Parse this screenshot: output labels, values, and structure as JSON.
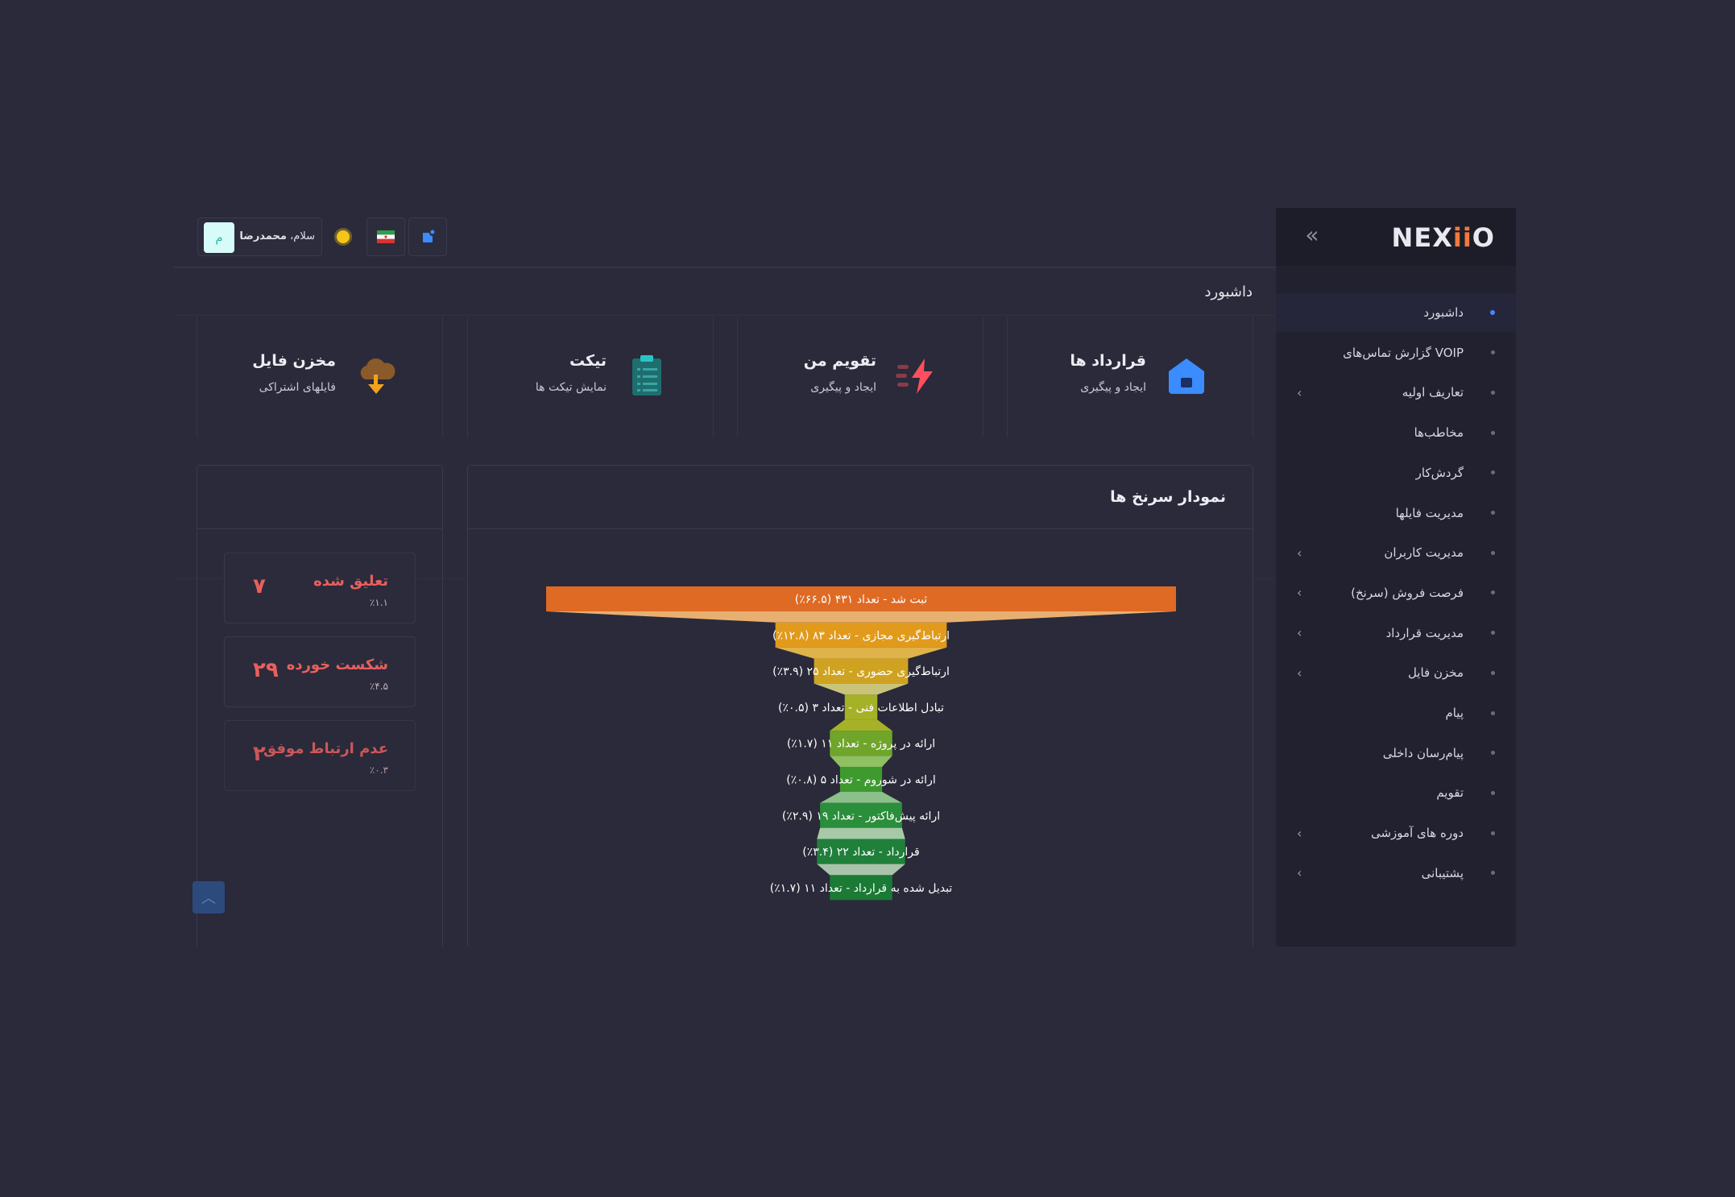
{
  "brand": {
    "logo_prefix": "NEX",
    "logo_ii": "ii",
    "logo_suffix": "O"
  },
  "sidebar": {
    "items": [
      {
        "label": "داشبورد",
        "active": true,
        "chevron": false
      },
      {
        "label": "گزارش تماس‌های VOIP",
        "chevron": false
      },
      {
        "label": "تعاریف اولیه",
        "chevron": true
      },
      {
        "label": "مخاطب‌ها",
        "chevron": false
      },
      {
        "label": "گردش‌کار",
        "chevron": false
      },
      {
        "label": "مدیریت فایلها",
        "chevron": false
      },
      {
        "label": "مدیریت کاربران",
        "chevron": true
      },
      {
        "label": "فرصت فروش (سرنخ)",
        "chevron": true
      },
      {
        "label": "مدیریت قرارداد",
        "chevron": true
      },
      {
        "label": "مخزن فایل",
        "chevron": true
      },
      {
        "label": "پیام",
        "chevron": false
      },
      {
        "label": "پیام‌رسان داخلی",
        "chevron": false
      },
      {
        "label": "تقویم",
        "chevron": false
      },
      {
        "label": "دوره های آموزشی",
        "chevron": true
      },
      {
        "label": "پشتیبانی",
        "chevron": true
      }
    ],
    "chevron_glyph": "‹"
  },
  "header": {
    "greeting_prefix": "سلام،",
    "user_name": "محمدرضا",
    "avatar_initial": "م",
    "page_title": "داشبورد"
  },
  "quick_cards": [
    {
      "title": "قرارداد ها",
      "subtitle": "ایجاد و پیگیری",
      "icon": "house-icon"
    },
    {
      "title": "تقویم من",
      "subtitle": "ایجاد و پیگیری",
      "icon": "lightning-icon"
    },
    {
      "title": "تیکت",
      "subtitle": "نمایش تیکت ها",
      "icon": "clipboard-icon"
    },
    {
      "title": "مخزن فایل",
      "subtitle": "فایلهای اشتراکی",
      "icon": "cloud-download-icon"
    }
  ],
  "funnel": {
    "title": "نمودار سرنخ ها"
  },
  "chart_data": {
    "type": "funnel",
    "stages": [
      {
        "label": "ثبت شد - تعداد ۴۳۱ (۶۶.۵٪)",
        "value": 431,
        "color": "#de6a24",
        "neck": "#e8b070"
      },
      {
        "label": "ارتباط‌گیری مجازی - تعداد ۸۳ (۱۲.۸٪)",
        "value": 83,
        "color": "#e19a1c",
        "neck": "#e0b24a"
      },
      {
        "label": "ارتباط‌گیری حضوری - تعداد ۲۵ (۳.۹٪)",
        "value": 25,
        "color": "#cfa321",
        "neck": "#c9c47a"
      },
      {
        "label": "تبادل اطلاعات فنی - تعداد ۳ (۰.۵٪)",
        "value": 3,
        "color": "#a5b126",
        "neck": "#a5b126"
      },
      {
        "label": "ارائه در پروژه - تعداد ۱۱ (۱.۷٪)",
        "value": 11,
        "color": "#6fa52b",
        "neck": "#8fc062"
      },
      {
        "label": "ارائه در شوروم - تعداد ۵ (۰.۸٪)",
        "value": 5,
        "color": "#3e9a2f",
        "neck": "#8cc08a"
      },
      {
        "label": "ارائه پیش‌فاکتور - تعداد ۱۹ (۲.۹٪)",
        "value": 19,
        "color": "#2a8e3a",
        "neck": "#a7c9a7"
      },
      {
        "label": "قرارداد - تعداد ۲۲ (۳.۴٪)",
        "value": 22,
        "color": "#207f3b",
        "neck": "#a9c4ab"
      },
      {
        "label": "تبدیل شده به قرارداد - تعداد ۱۱ (۱.۷٪)",
        "value": 11,
        "color": "#1b7a35",
        "neck": "#1b7a35"
      }
    ]
  },
  "status_cards": [
    {
      "label": "تعلیق شده",
      "percent": "٪۱.۱",
      "value": "۷"
    },
    {
      "label": "شکست خورده",
      "percent": "٪۴.۵",
      "value": "۲۹"
    },
    {
      "label": "عدم ارتباط موفق",
      "percent": "٪۰.۳",
      "value": "۲"
    }
  ],
  "colors": {
    "accent": "#4a86ff",
    "danger": "#e8605e",
    "bg": "#2a2a3a",
    "sidebar": "#21212f"
  }
}
